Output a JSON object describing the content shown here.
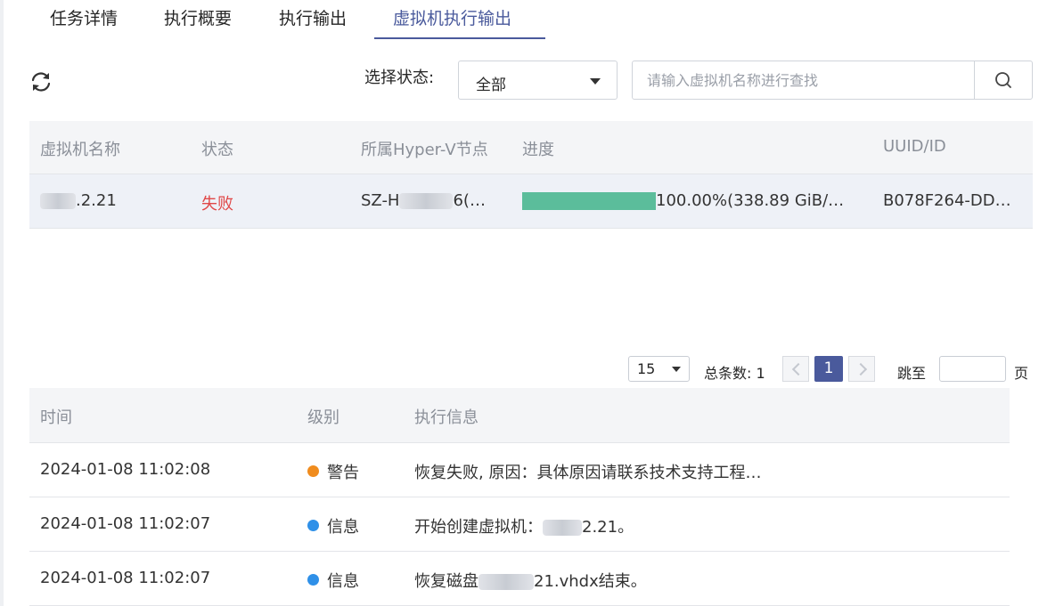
{
  "tabs": [
    {
      "label": "任务详情"
    },
    {
      "label": "执行概要"
    },
    {
      "label": "执行输出"
    },
    {
      "label": "虚拟机执行输出",
      "active": true
    }
  ],
  "toolbar": {
    "status_label": "选择状态:",
    "status_value": "全部",
    "search_placeholder": "请输入虚拟机名称进行查找"
  },
  "vm_table": {
    "headers": {
      "name": "虚拟机名称",
      "status": "状态",
      "node": "所属Hyper-V节点",
      "progress": "进度",
      "uuid": "UUID/ID"
    },
    "rows": [
      {
        "name_prefix": "",
        "name_suffix": ".2.21",
        "status": "失败",
        "node_prefix": "SZ-H",
        "node_suffix": "6(…",
        "progress_percent": 100,
        "progress_text": "100.00%(338.89 GiB/…",
        "uuid": "B078F264-DD…"
      }
    ]
  },
  "pagination": {
    "page_size": "15",
    "total_label": "总条数: 1",
    "current_page": "1",
    "jump_label": "跳至",
    "page_unit": "页"
  },
  "log_table": {
    "headers": {
      "time": "时间",
      "level": "级别",
      "info": "执行信息"
    },
    "rows": [
      {
        "time": "2024-01-08 11:02:08",
        "level": "警告",
        "level_color": "#f08c1e",
        "info_prefix": "恢复失败, 原因：具体原因请联系技术支持工程…",
        "info_suffix": ""
      },
      {
        "time": "2024-01-08 11:02:07",
        "level": "信息",
        "level_color": "#2f90e8",
        "info_prefix": "开始创建虚拟机：",
        "info_suffix": "2.21。"
      },
      {
        "time": "2024-01-08 11:02:07",
        "level": "信息",
        "level_color": "#2f90e8",
        "info_prefix": "恢复磁盘",
        "info_suffix": "21.vhdx结束。"
      }
    ]
  },
  "colors": {
    "accent": "#4a5a9c",
    "progress": "#5bbd9b",
    "fail": "#e04848"
  }
}
